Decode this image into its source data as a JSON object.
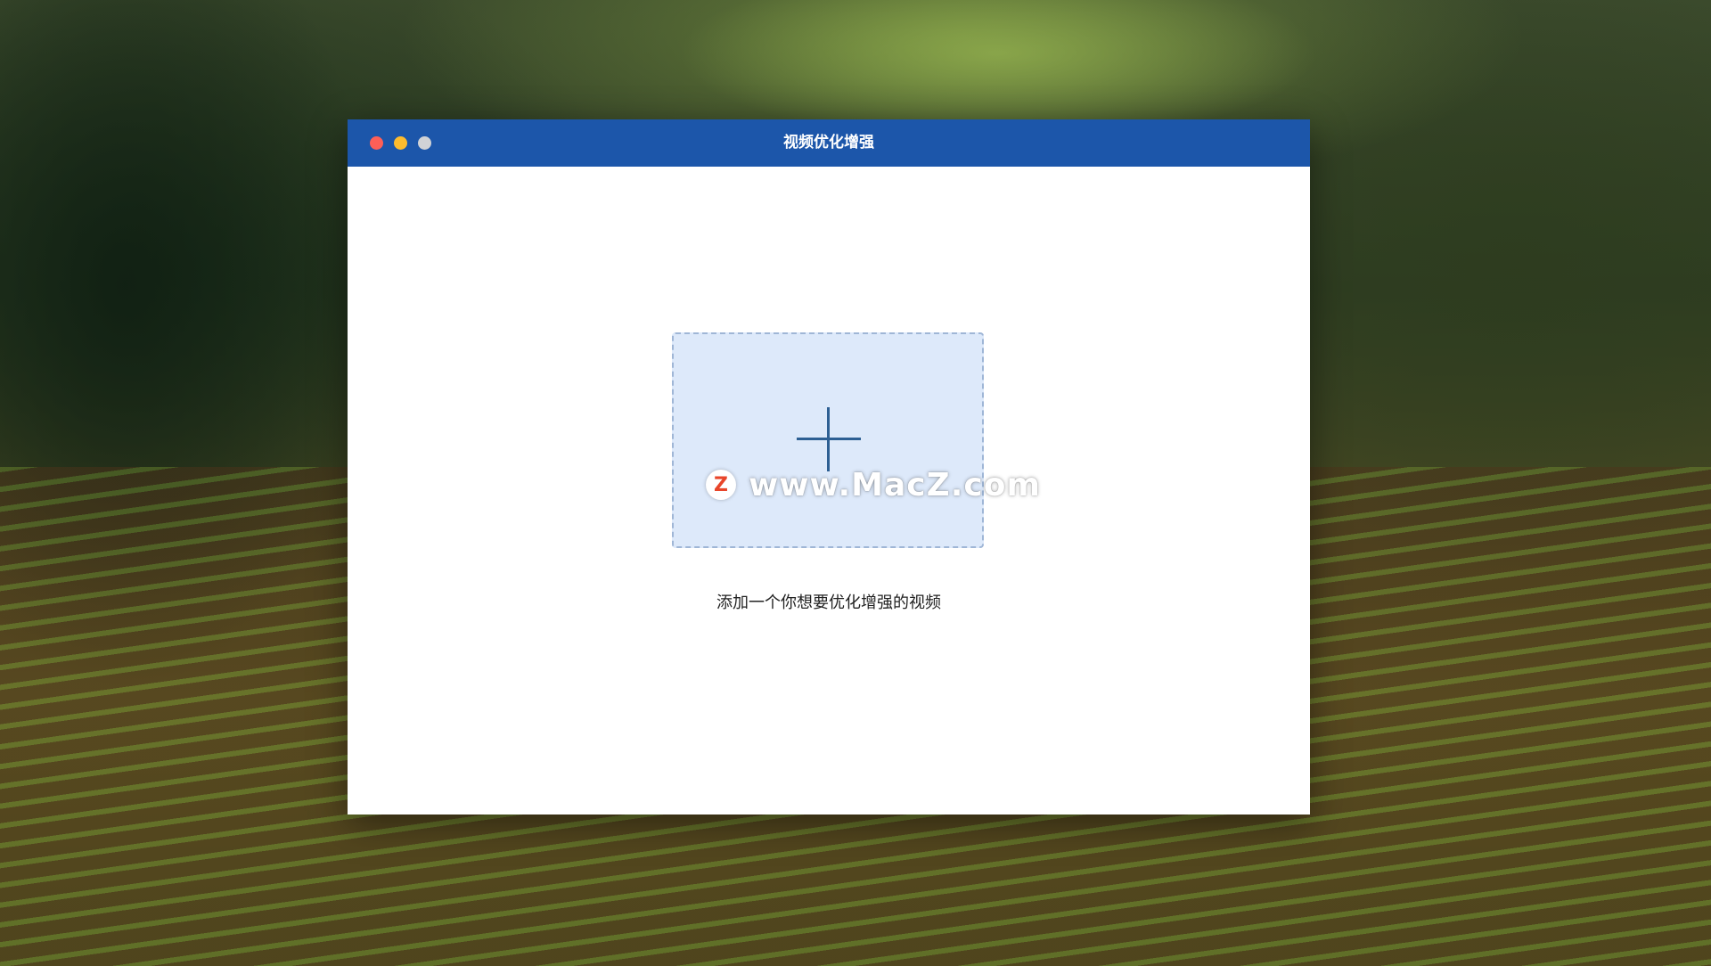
{
  "window": {
    "title": "视频优化增强",
    "accent_color": "#1c56aa"
  },
  "dropzone": {
    "icon": "plus-icon",
    "hint": "添加一个你想要优化增强的视频"
  },
  "watermark": {
    "logo_letter": "Z",
    "text": "www.MacZ.com"
  },
  "colors": {
    "traffic_close": "#fe5f57",
    "traffic_minimize": "#febc2e",
    "traffic_zoom": "#d0d2d6",
    "dropzone_fill": "#dde9fa"
  }
}
